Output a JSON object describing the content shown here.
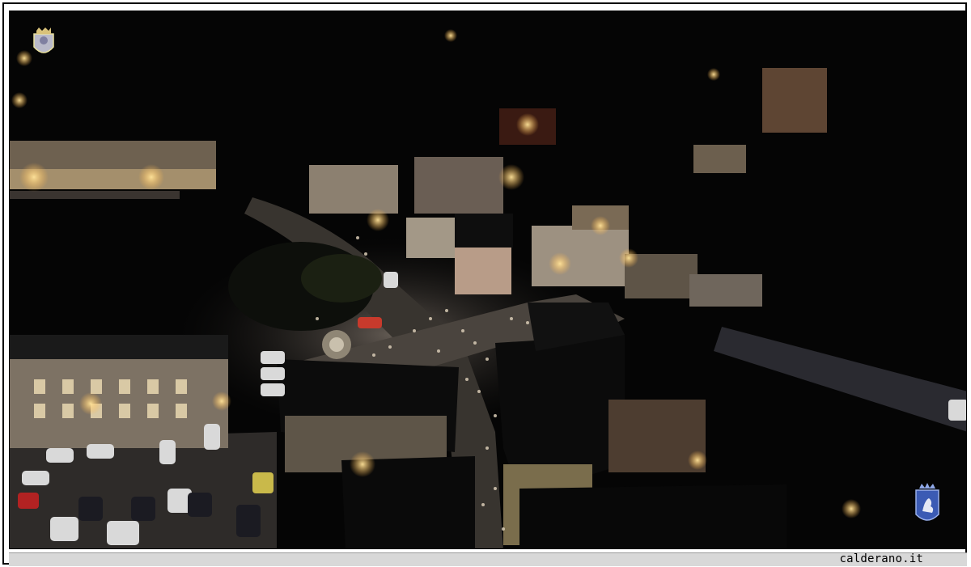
{
  "photo": {
    "subject": "aerial-night-town-square",
    "colors": {
      "sky": "#050505",
      "lamp": "#ffd27a",
      "wall_lit": "#9a8468",
      "roof_dark": "#0b0b0b",
      "street": "#3a3634"
    }
  },
  "crest_top_left": {
    "icon": "coat-of-arms-icon"
  },
  "crest_bottom_right": {
    "icon": "lion-shield-icon"
  },
  "footer": {
    "site_label": "calderano.it"
  }
}
